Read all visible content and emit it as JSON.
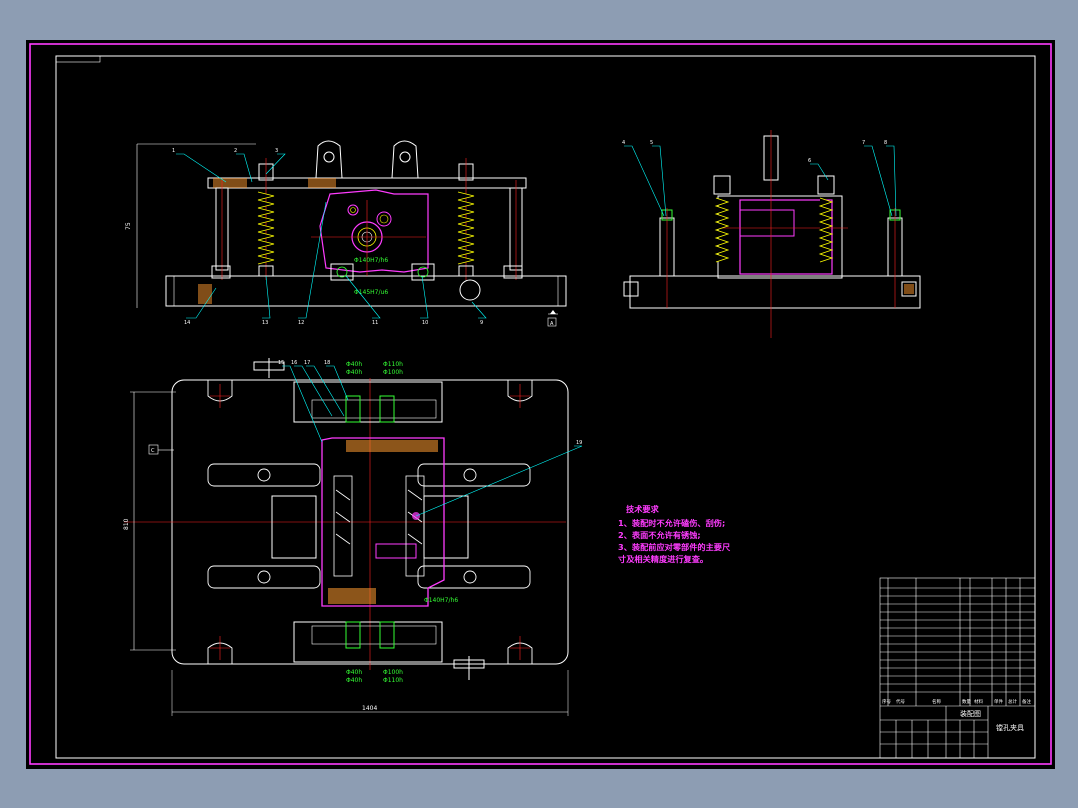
{
  "notes": {
    "title": "技术要求",
    "lines": [
      "1、装配时不允许磕伤、刮伤;",
      "2、表面不允许有锈蚀;",
      "3、装配前应对零部件的主要尺",
      "寸及相关精度进行复查。"
    ]
  },
  "title_block": {
    "drawing_name": "装配图",
    "part_name": "镗孔夹具",
    "header": [
      "序号",
      "代号",
      "名称",
      "数量",
      "材料",
      "单件",
      "总计",
      "备注"
    ]
  },
  "dimensions": {
    "width_top": "1404",
    "height_left": "810",
    "side_height": "75"
  },
  "fit_labels": {
    "front_1": "Φ140H7/h6",
    "front_2": "Φ145H7/u6",
    "plan_1": "Φ140H7/h6",
    "plan_top": [
      "Φ110h",
      "Φ100h",
      "Φ40h",
      "Φ40h"
    ],
    "plan_bot": [
      "Φ100h",
      "Φ110h",
      "Φ40h",
      "Φ40h"
    ]
  },
  "datum_marks": {
    "plan_left": "C",
    "front_right": "A"
  },
  "front_callouts": [
    "1",
    "2",
    "3",
    "14",
    "13",
    "12",
    "11",
    "10",
    "9"
  ],
  "side_callouts": [
    "4",
    "5",
    "6",
    "7",
    "8"
  ],
  "plan_callouts": [
    "15",
    "16",
    "17",
    "18",
    "19"
  ],
  "colors": {
    "background": "#000000",
    "frame": "#ff3cff",
    "outline": "#ffffff",
    "center": "#ff2020",
    "leader": "#00ffff",
    "workpiece": "#ff3cff",
    "fit": "#35ff35",
    "spring": "#ffff00",
    "hatch": "#ff9a30"
  }
}
